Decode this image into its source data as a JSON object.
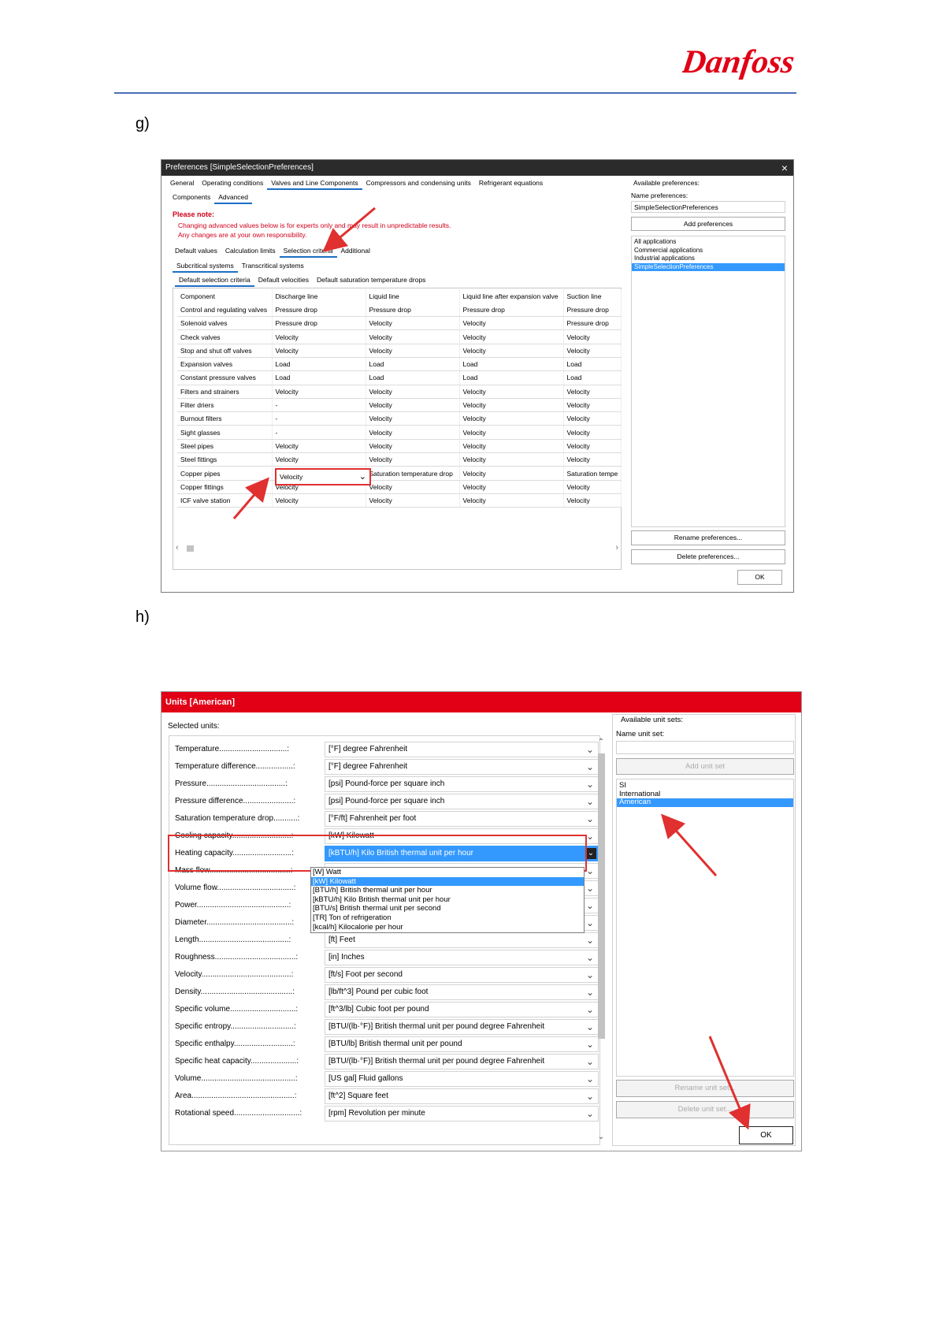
{
  "header": {
    "logo_text": "Danfoss"
  },
  "steps": {
    "g": "g)",
    "h": "h)"
  },
  "prefs_dialog": {
    "title": "Preferences [SimpleSelectionPreferences]",
    "close": "×",
    "main_tabs": [
      "General",
      "Operating conditions",
      "Valves and Line Components",
      "Compressors and condensing units",
      "Refrigerant equations"
    ],
    "sub_tabs": [
      "Components",
      "Advanced"
    ],
    "note_title": "Please note:",
    "note_lines": [
      "Changing advanced values below is for experts only and may result in unpredictable results.",
      "Any changes are at your own responsibility."
    ],
    "adv_tabs": [
      "Default values",
      "Calculation limits",
      "Selection criteria",
      "Additional"
    ],
    "system_tabs": [
      "Subcritical systems",
      "Transcritical systems"
    ],
    "crit_tabs": [
      "Default selection criteria",
      "Default velocities",
      "Default saturation temperature drops"
    ],
    "columns": [
      "Component",
      "Discharge line",
      "Liquid line",
      "Liquid line after expansion valve",
      "Suction line"
    ],
    "rows": [
      [
        "Control and regulating valves",
        "Pressure drop",
        "Pressure drop",
        "Pressure drop",
        "Pressure drop"
      ],
      [
        "Solenoid valves",
        "Pressure drop",
        "Velocity",
        "Velocity",
        "Pressure drop"
      ],
      [
        "Check valves",
        "Velocity",
        "Velocity",
        "Velocity",
        "Velocity"
      ],
      [
        "Stop and shut off valves",
        "Velocity",
        "Velocity",
        "Velocity",
        "Velocity"
      ],
      [
        "Expansion valves",
        "Load",
        "Load",
        "Load",
        "Load"
      ],
      [
        "Constant pressure valves",
        "Load",
        "Load",
        "Load",
        "Load"
      ],
      [
        "Filters and strainers",
        "Velocity",
        "Velocity",
        "Velocity",
        "Velocity"
      ],
      [
        "Filter driers",
        "-",
        "Velocity",
        "Velocity",
        "Velocity"
      ],
      [
        "Burnout filters",
        "-",
        "Velocity",
        "Velocity",
        "Velocity"
      ],
      [
        "Sight glasses",
        "-",
        "Velocity",
        "Velocity",
        "Velocity"
      ],
      [
        "Steel pipes",
        "Velocity",
        "Velocity",
        "Velocity",
        "Velocity"
      ],
      [
        "Steel fittings",
        "Velocity",
        "Velocity",
        "Velocity",
        "Velocity"
      ],
      [
        "Copper pipes",
        "Velocity",
        "Saturation temperature drop",
        "Velocity",
        "Saturation tempe"
      ],
      [
        "Copper fittings",
        "Velocity",
        "Velocity",
        "Velocity",
        "Velocity"
      ],
      [
        "ICF valve station",
        "Velocity",
        "Velocity",
        "Velocity",
        "Velocity"
      ]
    ],
    "selected_cell_value": "Velocity",
    "available_label": "Available preferences:",
    "name_label": "Name preferences:",
    "name_value": "SimpleSelectionPreferences",
    "add_button": "Add preferences",
    "pref_list": [
      "All applications",
      "Commercial applications",
      "Industrial applications",
      "SimpleSelectionPreferences"
    ],
    "rename_button": "Rename preferences...",
    "delete_button": "Delete preferences...",
    "ok_button": "OK"
  },
  "units_dialog": {
    "title": "Units [American]",
    "selected_label": "Selected units:",
    "rows": [
      {
        "label": "Temperature...............................:",
        "value": "[°F] degree Fahrenheit"
      },
      {
        "label": "Temperature difference.................:",
        "value": "[°F] degree Fahrenheit"
      },
      {
        "label": "Pressure....................................:",
        "value": "[psi] Pound-force per square inch"
      },
      {
        "label": "Pressure difference.......................:",
        "value": "[psi] Pound-force per square inch"
      },
      {
        "label": "Saturation temperature drop...........:",
        "value": "[°F/ft] Fahrenheit per foot"
      },
      {
        "label": "Cooling capacity...........................:",
        "value": "[kW] Kilowatt"
      },
      {
        "label": "Heating capacity...........................:",
        "value": "[kBTU/h] Kilo British thermal unit per hour"
      },
      {
        "label": "Mass flow.....................................:",
        "value": ""
      },
      {
        "label": "Volume flow...................................:",
        "value": ""
      },
      {
        "label": "Power..........................................:",
        "value": ""
      },
      {
        "label": "Diameter.......................................:",
        "value": "[in] Inches"
      },
      {
        "label": "Length.........................................:",
        "value": "[ft] Feet"
      },
      {
        "label": "Roughness.....................................:",
        "value": "[in] Inches"
      },
      {
        "label": "Velocity.........................................:",
        "value": "[ft/s] Foot per second"
      },
      {
        "label": "Density..........................................:",
        "value": "[lb/ft^3] Pound per cubic foot"
      },
      {
        "label": "Specific volume..............................:",
        "value": "[ft^3/lb] Cubic foot per pound"
      },
      {
        "label": "Specific entropy.............................:",
        "value": "[BTU/(lb·°F)] British thermal unit per pound degree Fahrenheit"
      },
      {
        "label": "Specific enthalpy...........................:",
        "value": "[BTU/lb] British thermal unit per pound"
      },
      {
        "label": "Specific heat capacity.....................:",
        "value": "[BTU/(lb·°F)] British thermal unit per pound degree Fahrenheit"
      },
      {
        "label": "Volume...........................................:",
        "value": "[US gal] Fluid gallons"
      },
      {
        "label": "Area...............................................:",
        "value": "[ft^2] Square feet"
      },
      {
        "label": "Rotational speed..............................:",
        "value": "[rpm] Revolution per minute"
      }
    ],
    "dropdown_options": [
      "[W] Watt",
      "[kW] Kilowatt",
      "[BTU/h] British thermal unit per hour",
      "[kBTU/h] Kilo British thermal unit per hour",
      "[BTU/s] British thermal unit per second",
      "[TR] Ton of refrigeration",
      "[kcal/h] Kilocalorie per hour"
    ],
    "dropdown_selected": 1,
    "available_label": "Available unit sets:",
    "name_label": "Name unit set:",
    "add_button": "Add unit set",
    "unit_sets": [
      "SI",
      "International",
      "American"
    ],
    "selected_set": 2,
    "rename_button": "Rename unit set...",
    "delete_button": "Delete unit set...",
    "ok_button": "OK"
  },
  "colors": {
    "danfoss_red": "#e10016",
    "accent_blue": "#3399ff",
    "arrow_red": "#e03030"
  }
}
